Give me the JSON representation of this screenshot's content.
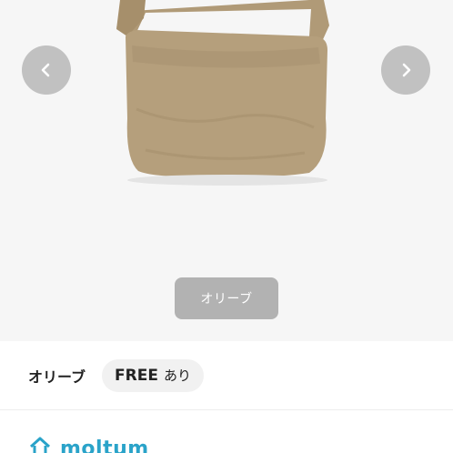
{
  "gallery": {
    "color_caption": "オリーブ",
    "prev_icon": "chevron-left-icon",
    "next_icon": "chevron-right-icon"
  },
  "variant": {
    "color": "オリーブ",
    "size": "FREE",
    "availability": "あり"
  },
  "brand": {
    "name": "moltum",
    "color": "#2aa3c9"
  },
  "colors": {
    "bag": "#b59f7c",
    "background": "#f6f6f6"
  }
}
